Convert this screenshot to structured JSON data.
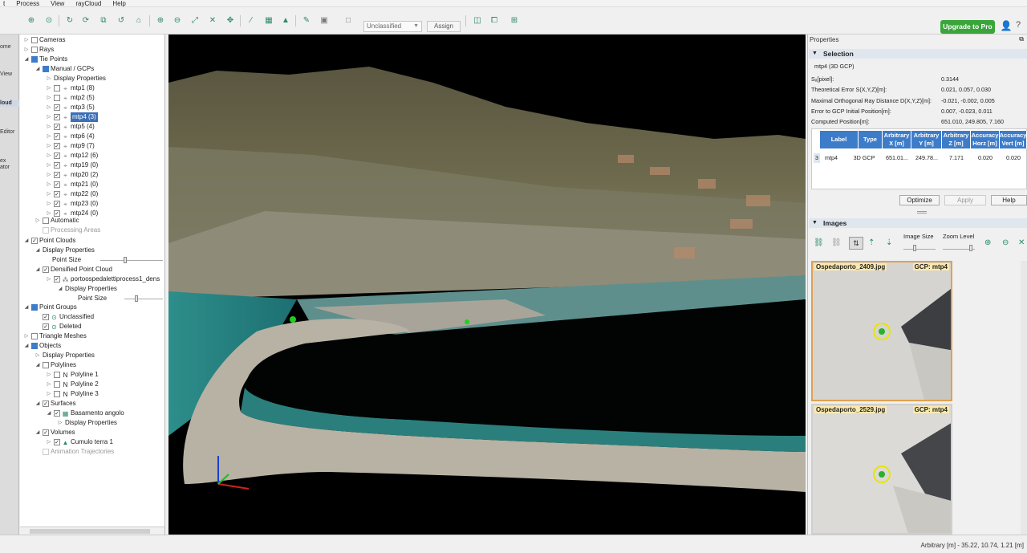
{
  "menu": [
    "t",
    "Process",
    "View",
    "rayCloud",
    "Help"
  ],
  "toolbar": {
    "class_select": "Unclassified",
    "assign": "Assign",
    "upgrade": "Upgrade to Pro"
  },
  "sidebar": [
    {
      "label": "ome"
    },
    {
      "label": "View"
    },
    {
      "label": "loud"
    },
    {
      "label": "Editor"
    },
    {
      "label": "ex ator"
    }
  ],
  "tree": {
    "cameras": "Cameras",
    "rays": "Rays",
    "tie_points": "Tie Points",
    "manual_gcps": "Manual / GCPs",
    "display_properties": "Display Properties",
    "mtps": [
      {
        "label": "mtp1 (8)",
        "checked": false
      },
      {
        "label": "mtp2 (5)",
        "checked": false
      },
      {
        "label": "mtp3 (5)",
        "checked": true
      },
      {
        "label": "mtp4 (3)",
        "checked": true
      },
      {
        "label": "mtp5 (4)",
        "checked": true
      },
      {
        "label": "mtp6 (4)",
        "checked": true
      },
      {
        "label": "mtp9 (7)",
        "checked": true
      },
      {
        "label": "mtp12 (6)",
        "checked": true
      },
      {
        "label": "mtp19 (0)",
        "checked": true
      },
      {
        "label": "mtp20 (2)",
        "checked": true
      },
      {
        "label": "mtp21 (0)",
        "checked": true
      },
      {
        "label": "mtp22 (0)",
        "checked": true
      },
      {
        "label": "mtp23 (0)",
        "checked": true
      },
      {
        "label": "mtp24 (0)",
        "checked": true
      }
    ],
    "automatic": "Automatic",
    "processing_areas": "Processing Areas",
    "point_clouds": "Point Clouds",
    "pc_display_properties": "Display Properties",
    "point_size": "Point Size",
    "densified": "Densified Point Cloud",
    "dense_file": "portoospedalettiprocess1_dens",
    "dense_display_properties": "Display Properties",
    "dense_point_size": "Point Size",
    "point_groups": "Point Groups",
    "unclassified": "Unclassified",
    "deleted": "Deleted",
    "triangle_meshes": "Triangle Meshes",
    "objects": "Objects",
    "obj_display_properties": "Display Properties",
    "polylines": "Polylines",
    "polyline_items": [
      "Polyline 1",
      "Polyline 2",
      "Polyline 3"
    ],
    "surfaces": "Surfaces",
    "basamento": "Basamento angolo",
    "surf_display_properties": "Display Properties",
    "volumes": "Volumes",
    "cumulo": "Cumulo terra 1",
    "animation": "Animation Trajectories"
  },
  "properties": {
    "title": "Properties",
    "selection": "Selection",
    "subtitle": "mtp4 (3D GCP)",
    "rows": [
      {
        "label": "Sₐ[pixel]:",
        "value": "0.3144"
      },
      {
        "label": "Theoretical Error S(X,Y,Z)[m]:",
        "value": "0.021, 0.057, 0.030"
      },
      {
        "label": "Maximal Orthogonal Ray Distance D(X,Y,Z)[m]:",
        "value": "-0.021, -0.002, 0.005"
      },
      {
        "label": "Error to GCP Initial Position[m]:",
        "value": "0.007, -0.023, 0.011"
      },
      {
        "label": "Computed Position[m]:",
        "value": "651.010, 249.805, 7.160"
      }
    ],
    "table": {
      "headers": [
        "Label",
        "Type",
        "Arbitrary X [m]",
        "Arbitrary Y [m]",
        "Arbitrary Z [m]",
        "Accuracy Horz [m]",
        "Accuracy Vert [m]"
      ],
      "row": {
        "idx": "3",
        "cells": [
          "mtp4",
          "3D GCP",
          "651.01...",
          "249.78...",
          "7.171",
          "0.020",
          "0.020"
        ]
      }
    },
    "buttons": {
      "optimize": "Optimize",
      "apply": "Apply",
      "help": "Help"
    }
  },
  "images": {
    "title": "Images",
    "image_size": "Image Size",
    "zoom_level": "Zoom Level",
    "thumbs": [
      {
        "name": "Ospedaporto_2409.jpg",
        "gcp": "GCP: mtp4"
      },
      {
        "name": "Ospedaporto_2529.jpg",
        "gcp": "GCP: mtp4"
      }
    ]
  },
  "status": "Arbitrary [m] - 35.22, 10.74, 1.21 [m]",
  "colors": {
    "accent": "#3d7cc9",
    "upgrade": "#3aa53a",
    "thumb_selected": "#e0a14f"
  }
}
